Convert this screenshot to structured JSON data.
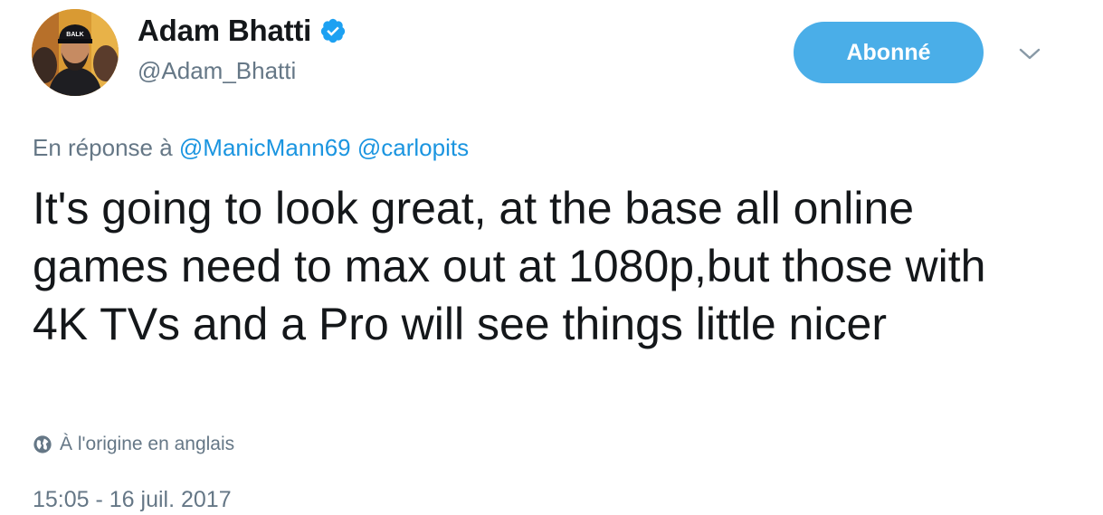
{
  "tweet": {
    "author": {
      "name": "Adam Bhatti",
      "handle": "@Adam_Bhatti",
      "verified": true,
      "avatar_icon": "profile-photo"
    },
    "follow_button": {
      "label": "Abonné",
      "color": "#4aaee8"
    },
    "menu_icon": "chevron-down-icon",
    "reply_context": {
      "prefix": "En réponse à",
      "mentions": [
        "@ManicMann69",
        "@carlopits"
      ]
    },
    "text": "It's going to look great, at the base all online games need to max out at 1080p,but those with 4K TVs and a Pro will see things little nicer",
    "translation_note": {
      "icon": "globe-icon",
      "label": "À l'origine en anglais"
    },
    "timestamp": "15:05 - 16 juil. 2017"
  },
  "colors": {
    "text_primary": "#14171a",
    "text_secondary": "#657786",
    "link": "#1b95e0",
    "verified_badge": "#1da1f2"
  }
}
